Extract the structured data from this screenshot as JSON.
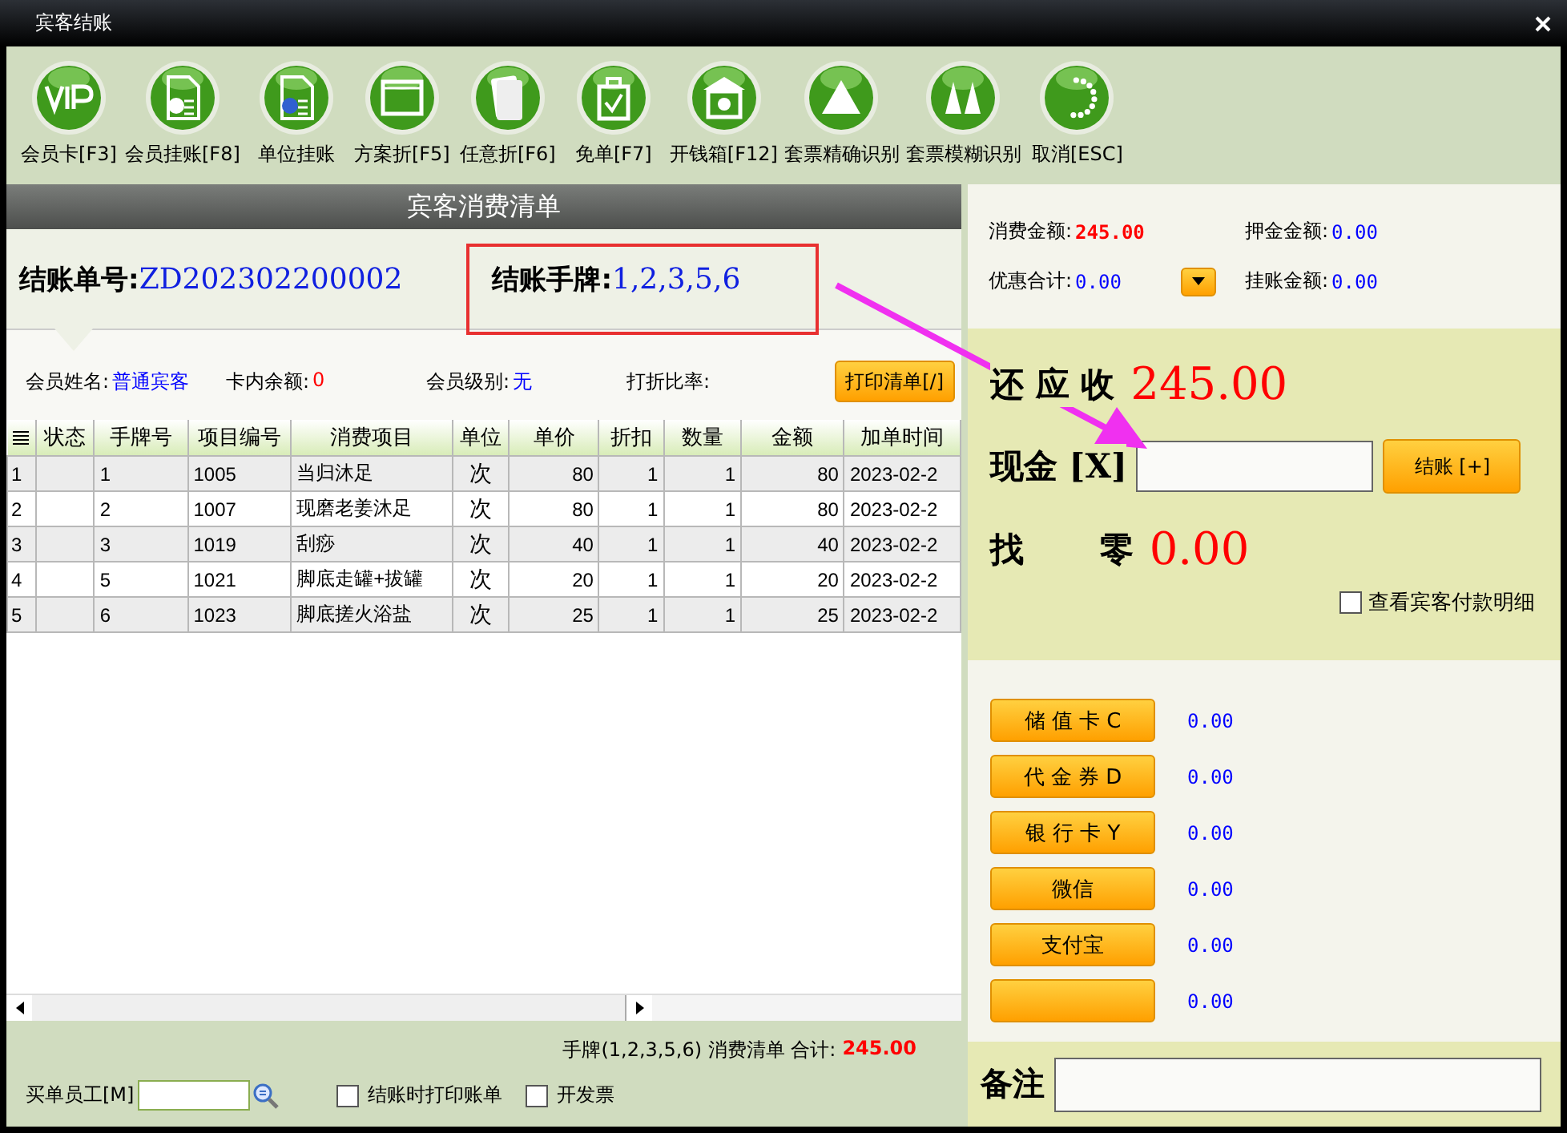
{
  "window": {
    "title": "宾客结账"
  },
  "toolbar": [
    {
      "label": "会员卡[F3]",
      "kind": "vip"
    },
    {
      "label": "会员挂账[F8]",
      "kind": "vip-document"
    },
    {
      "label": "单位挂账",
      "kind": "user-document"
    },
    {
      "label": "方案折[F5]",
      "kind": "window"
    },
    {
      "label": "任意折[F6]",
      "kind": "cards"
    },
    {
      "label": "免单[F7]",
      "kind": "bag"
    },
    {
      "label": "开钱箱[F12]",
      "kind": "cashbox"
    },
    {
      "label": "套票精确识别",
      "kind": "triangle"
    },
    {
      "label": "套票模糊识别",
      "kind": "peaks"
    },
    {
      "label": "取消[ESC]",
      "kind": "spinner"
    }
  ],
  "bill": {
    "title": "宾客消费清单",
    "order_label": "结账单号:",
    "order_no": "ZD202302200002",
    "tags_label": "结账手牌:",
    "tags": "1,2,3,5,6",
    "member_fields": [
      {
        "label": "会员姓名:",
        "value": "普通宾客",
        "kind": "blue"
      },
      {
        "label": "卡内余额:",
        "value": "0",
        "kind": "red"
      },
      {
        "label": "会员级别:",
        "value": "无",
        "kind": "blue"
      },
      {
        "label": "打折比率:"
      }
    ],
    "print_button": "打印清单[/]",
    "table": {
      "columns": [
        "",
        "状态",
        "手牌号",
        "项目编号",
        "消费项目",
        "单位",
        "单价",
        "折扣",
        "数量",
        "金额",
        "加单时间"
      ],
      "rows": [
        [
          "1",
          "",
          "1",
          "1005",
          "当归沐足",
          "次",
          "80",
          "1",
          "1",
          "80",
          "2023-02-2"
        ],
        [
          "2",
          "",
          "2",
          "1007",
          "现磨老姜沐足",
          "次",
          "80",
          "1",
          "1",
          "80",
          "2023-02-2"
        ],
        [
          "3",
          "",
          "3",
          "1019",
          "刮痧",
          "次",
          "40",
          "1",
          "1",
          "40",
          "2023-02-2"
        ],
        [
          "4",
          "",
          "5",
          "1021",
          "脚底走罐+拔罐",
          "次",
          "20",
          "1",
          "1",
          "20",
          "2023-02-2"
        ],
        [
          "5",
          "",
          "6",
          "1023",
          "脚底搓火浴盐",
          "次",
          "25",
          "1",
          "1",
          "25",
          "2023-02-2"
        ]
      ]
    },
    "summary": "手牌(1,2,3,5,6) 消费清单 合计:",
    "total": "245.00",
    "staff_label": "买单员工[M]",
    "options": [
      {
        "label": "结账时打印账单",
        "checked": false
      },
      {
        "label": "开发票",
        "checked": false
      }
    ]
  },
  "payment": {
    "amounts": [
      {
        "label": "消费金额:",
        "value": "245.00",
        "kind": "red"
      },
      {
        "label": "押金金额:",
        "value": "0.00",
        "kind": "blue"
      },
      {
        "label": "优惠合计:",
        "value": "0.00",
        "kind": "blue"
      },
      {
        "label": "挂账金额:",
        "value": "0.00",
        "kind": "blue"
      }
    ],
    "due_label": "还 应 收",
    "due": "245.00",
    "cash_label": "现金 [X]",
    "settle_button": "结账 [+]",
    "change_label": "找 零",
    "change": "0.00",
    "detail_option": {
      "label": "查看宾客付款明细",
      "checked": false
    },
    "methods": [
      {
        "label": "储 值 卡 C",
        "value": "0.00"
      },
      {
        "label": "代 金 券 D",
        "value": "0.00"
      },
      {
        "label": "银 行 卡 Y",
        "value": "0.00"
      },
      {
        "label": "微信",
        "value": "0.00"
      },
      {
        "label": "支付宝",
        "value": "0.00"
      },
      {
        "value": "0.00"
      }
    ],
    "remark_label": "备注"
  }
}
